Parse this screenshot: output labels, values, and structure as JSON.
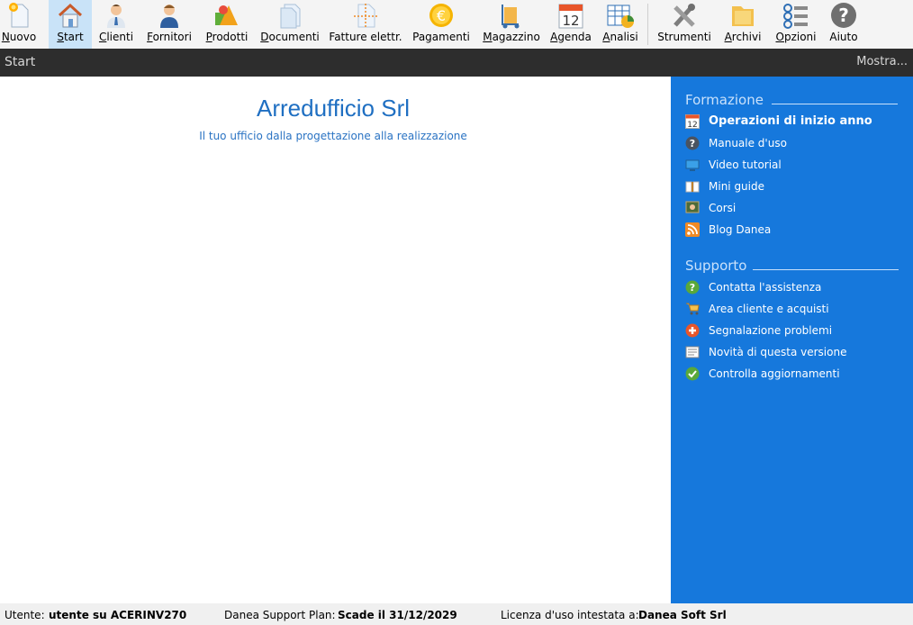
{
  "toolbar": {
    "items": [
      {
        "label": "Nuovo",
        "underline": "N",
        "rest": "uovo",
        "icon": "new-document-icon"
      },
      {
        "label": "Start",
        "underline": "S",
        "rest": "tart",
        "icon": "home-icon"
      },
      {
        "label": "Clienti",
        "underline": "C",
        "rest": "lienti",
        "icon": "customer-icon"
      },
      {
        "label": "Fornitori",
        "underline": "F",
        "rest": "ornitori",
        "icon": "supplier-icon"
      },
      {
        "label": "Prodotti",
        "underline": "P",
        "rest": "rodotti",
        "icon": "products-icon"
      },
      {
        "label": "Documenti",
        "underline": "D",
        "rest": "ocumenti",
        "icon": "documents-icon"
      },
      {
        "label": "Fatture elettr.",
        "icon": "e-invoice-icon"
      },
      {
        "label": "Pagamenti",
        "icon": "payments-icon"
      },
      {
        "label": "Magazzino",
        "underline": "M",
        "rest": "agazzino",
        "icon": "warehouse-icon"
      },
      {
        "label": "Agenda",
        "underline": "A",
        "rest": "genda",
        "icon": "calendar-icon",
        "day": "12"
      },
      {
        "label": "Analisi",
        "underline": "A",
        "rest": "nalisi",
        "icon": "analysis-icon"
      },
      {
        "label": "Strumenti",
        "icon": "tools-icon"
      },
      {
        "label": "Archivi",
        "underline": "A",
        "rest": "rchivi",
        "icon": "archive-icon"
      },
      {
        "label": "Opzioni",
        "underline": "O",
        "rest": "pzioni",
        "icon": "options-icon"
      },
      {
        "label": "Aiuto",
        "icon": "help-icon"
      }
    ]
  },
  "subbar": {
    "title": "Start",
    "more": "Mostra..."
  },
  "main": {
    "company": "Arredufficio Srl",
    "tagline": "Il tuo ufficio dalla progettazione alla realizzazione"
  },
  "panel": {
    "formazione": {
      "title": "Formazione",
      "items": [
        {
          "label": "Operazioni di inizio anno",
          "icon": "calendar-icon",
          "day": "12"
        },
        {
          "label": "Manuale d'uso",
          "icon": "question-icon"
        },
        {
          "label": "Video tutorial",
          "icon": "monitor-icon"
        },
        {
          "label": "Mini guide",
          "icon": "book-icon"
        },
        {
          "label": "Corsi",
          "icon": "teacher-icon"
        },
        {
          "label": "Blog Danea",
          "icon": "rss-icon"
        }
      ]
    },
    "supporto": {
      "title": "Supporto",
      "items": [
        {
          "label": "Contatta l'assistenza",
          "icon": "support-icon"
        },
        {
          "label": "Area cliente e acquisti",
          "icon": "cart-icon"
        },
        {
          "label": "Segnalazione problemi",
          "icon": "report-problem-icon"
        },
        {
          "label": "Novità di questa versione",
          "icon": "news-icon"
        },
        {
          "label": "Controlla aggiornamenti",
          "icon": "check-icon"
        }
      ]
    }
  },
  "status": {
    "user_label": "Utente:",
    "user_value": "utente su ACERINV270",
    "plan_label": "Danea Support Plan:",
    "plan_value": "Scade il 31/12/2029",
    "license_label": "Licenza d'uso intestata a:",
    "license_value": "Danea Soft Srl"
  }
}
